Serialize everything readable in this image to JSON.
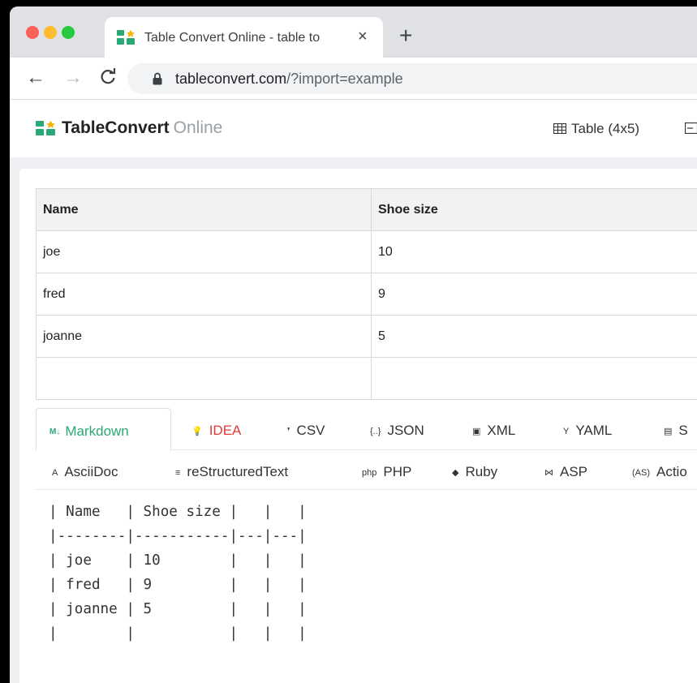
{
  "browser": {
    "tab_title": "Table Convert Online - table to",
    "tab_close": "×",
    "new_tab": "+",
    "url_host": "tableconvert.com",
    "url_rest": "/?import=example"
  },
  "site": {
    "brand": "TableConvert",
    "brand_sub": "Online",
    "table_size": "Table (4x5)"
  },
  "table": {
    "headers": [
      "Name",
      "Shoe size"
    ],
    "rows": [
      [
        "joe",
        "10"
      ],
      [
        "fred",
        "9"
      ],
      [
        "joanne",
        "5"
      ],
      [
        "",
        ""
      ]
    ]
  },
  "formats_row1": [
    {
      "icon": "M↓",
      "label": "Markdown"
    },
    {
      "icon": "💡",
      "label": "IDEA"
    },
    {
      "icon": "❜",
      "label": "CSV"
    },
    {
      "icon": "{..}",
      "label": "JSON"
    },
    {
      "icon": "▣",
      "label": "XML"
    },
    {
      "icon": "Y",
      "label": "YAML"
    },
    {
      "icon": "▤",
      "label": "S"
    }
  ],
  "formats_row2": [
    {
      "icon": "A",
      "label": "AsciiDoc"
    },
    {
      "icon": "≡",
      "label": "reStructuredText"
    },
    {
      "icon": "php",
      "label": "PHP"
    },
    {
      "icon": "◆",
      "label": "Ruby"
    },
    {
      "icon": "⋈",
      "label": "ASP"
    },
    {
      "icon": "(AS)",
      "label": "Actio"
    }
  ],
  "output_lines": [
    "| Name   | Shoe size |   |   |",
    "|--------|-----------|---|---|",
    "| joe    | 10        |   |   |",
    "| fred   | 9         |   |   |",
    "| joanne | 5         |   |   |",
    "|        |           |   |   |"
  ],
  "colors": {
    "accent": "#2aa876",
    "idea": "#e23b3b",
    "tabstrip": "#dfe1e5"
  }
}
